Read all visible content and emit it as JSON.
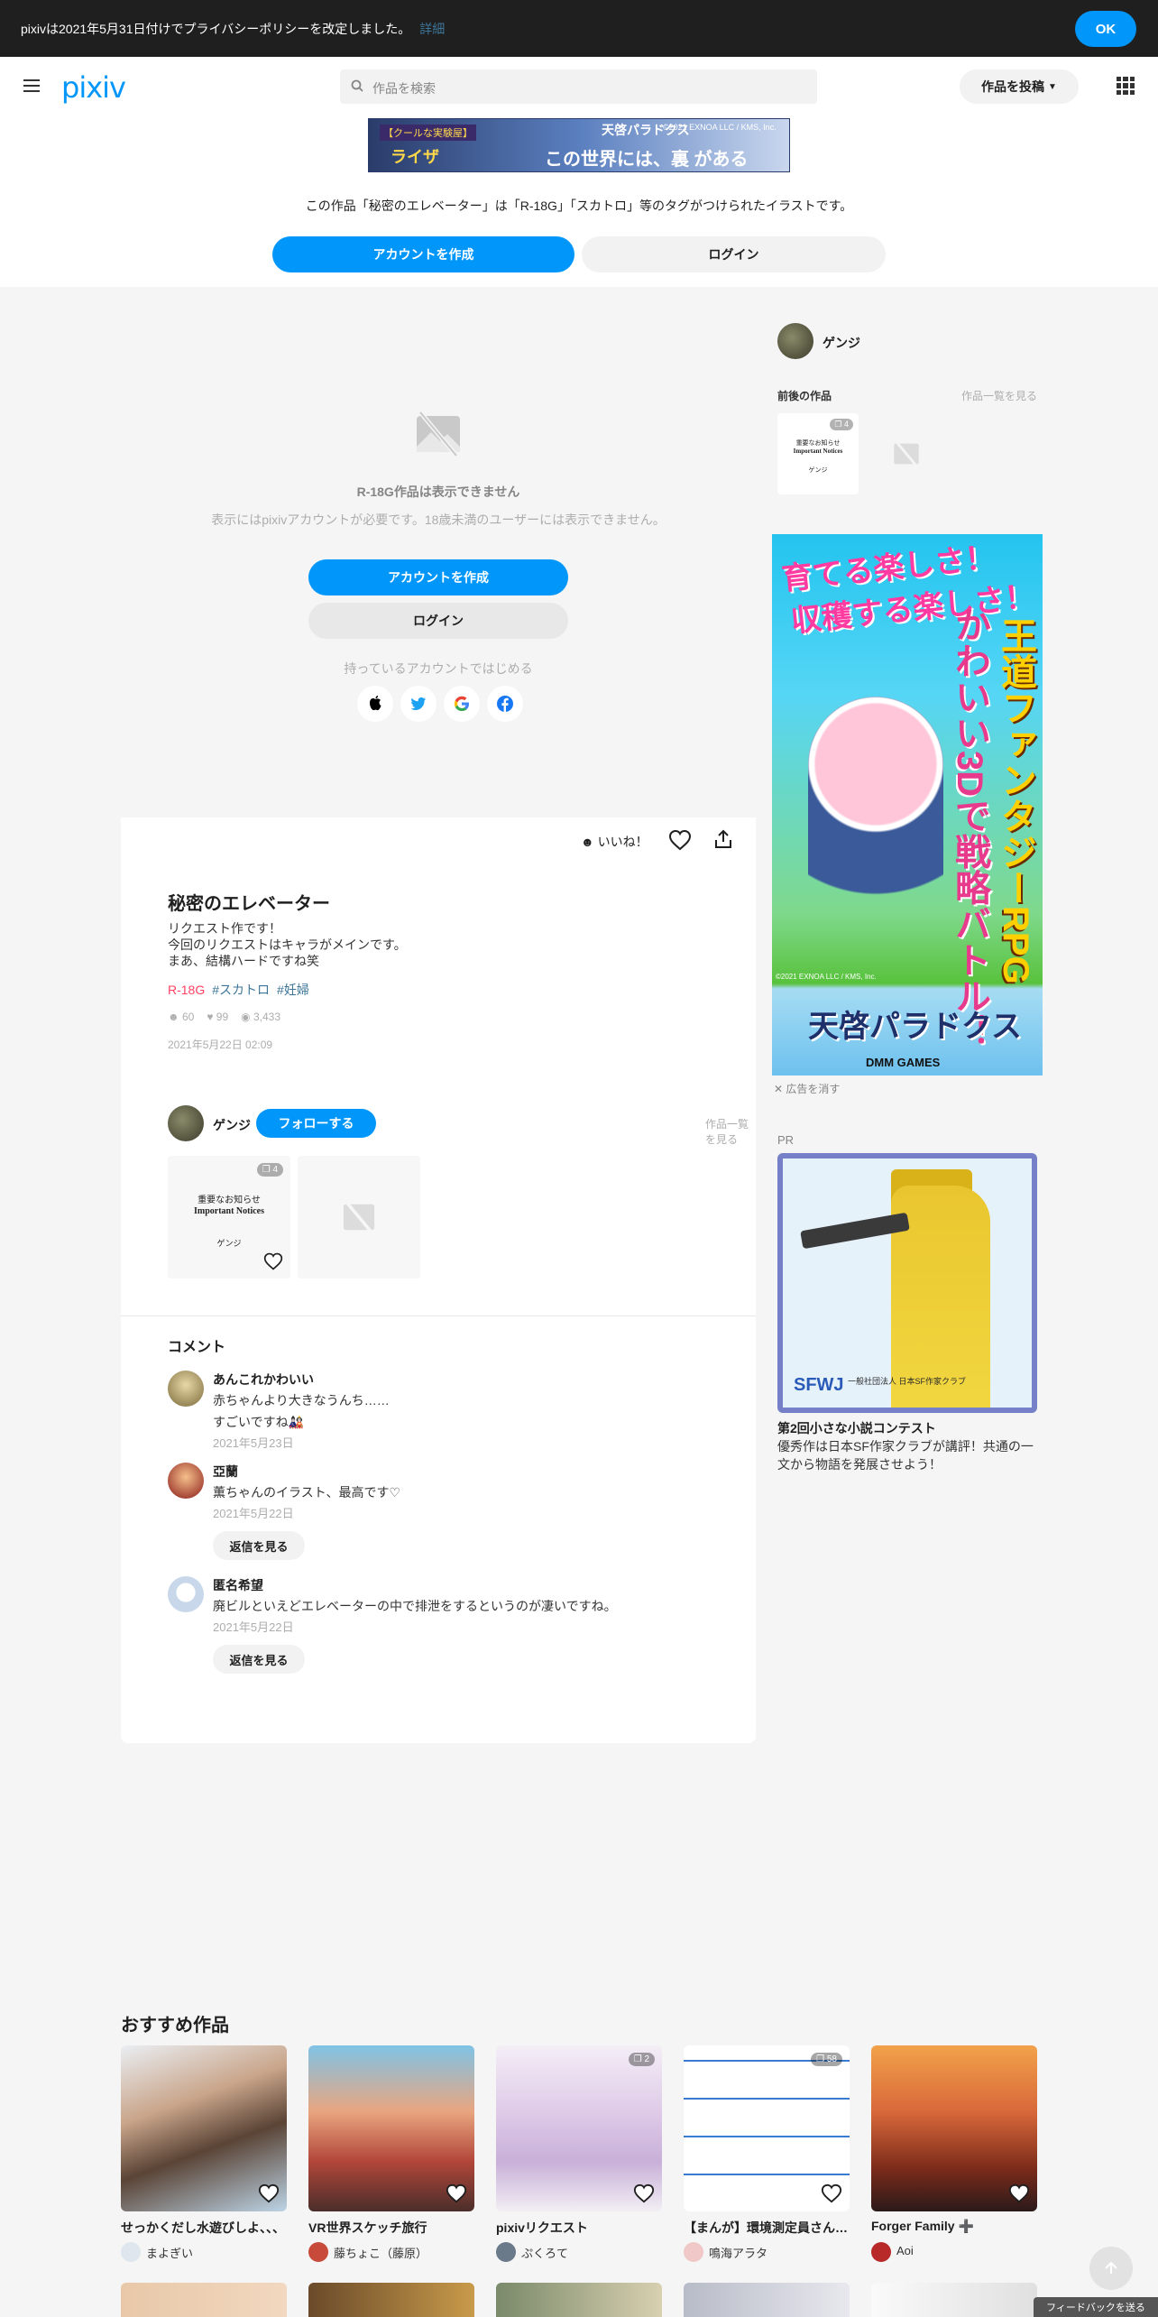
{
  "privacy": {
    "text": "pixivは2021年5月31日付けでプライバシーポリシーを改定しました。",
    "link": "詳細",
    "ok": "OK"
  },
  "header": {
    "logo": "pixiv",
    "search_placeholder": "作品を検索",
    "post_button": "作品を投稿"
  },
  "top_ad": {
    "badge": "【クールな実験屋】",
    "name": "ライザ",
    "game": "天啓パラドクス",
    "copyright": "©2021 EXNOA LLC / KMS, Inc.",
    "slogan": "この世界には、裏 がある"
  },
  "notice": "この作品「秘密のエレベーター」は「R-18G」「スカトロ」等のタグがつけられたイラストです。",
  "auth": {
    "create": "アカウントを作成",
    "login": "ログイン"
  },
  "blocked": {
    "title": "R-18G作品は表示できません",
    "subtitle": "表示にはpixivアカウントが必要です。18歳未満のユーザーには表示できません。",
    "create": "アカウントを作成",
    "login": "ログイン",
    "existing": "持っているアカウントではじめる"
  },
  "work": {
    "like_label": "いいね！",
    "title": "秘密のエレベーター",
    "description": [
      "リクエスト作です！",
      "今回のリクエストはキャラがメインです。",
      "まあ、結構ハードですね笑"
    ],
    "tags": [
      "R-18G",
      "#スカトロ",
      "#妊婦"
    ],
    "likes": "60",
    "bookmarks": "99",
    "views": "3,433",
    "date": "2021年5月22日 02:09"
  },
  "author": {
    "name": "ゲンジ",
    "follow": "フォローする",
    "see_all": "作品一覧を見る",
    "thumb": {
      "pages": "4",
      "line1": "重要なお知らせ",
      "line2": "Important Notices",
      "line3": "ゲンジ"
    }
  },
  "comments": {
    "heading": "コメント",
    "items": [
      {
        "name": "あんこれかわいい",
        "lines": [
          "赤ちゃんより大きなうんち……",
          "すごいですね🎎"
        ],
        "date": "2021年5月23日",
        "reply": ""
      },
      {
        "name": "亞蘭",
        "lines": [
          "薫ちゃんのイラスト、最高です♡"
        ],
        "date": "2021年5月22日",
        "reply": "返信を見る"
      },
      {
        "name": "匿名希望",
        "lines": [
          "廃ビルといえどエレベーターの中で排泄をするというのが凄いですね。"
        ],
        "date": "2021年5月22日",
        "reply": "返信を見る"
      }
    ]
  },
  "sidebar": {
    "author_name": "ゲンジ",
    "prev_next": "前後の作品",
    "see_all": "作品一覧を見る",
    "thumb": {
      "pages": "4",
      "line1": "重要なお知らせ",
      "line2": "Important Notices",
      "line3": "ゲンジ"
    },
    "ad": {
      "line1": "育てる楽しさ！",
      "line2": "収穫する楽しさ！",
      "vert1": "かわいい3Dで戦略バトル！",
      "vert2": "王道ファンタジーRPG",
      "copyright": "©2021 EXNOA LLC / KMS, Inc.",
      "logo": "天啓パラドクス",
      "brand": "DMM GAMES"
    },
    "ad_close": "広告を消す",
    "pr_label": "PR",
    "pr_logo": "SFWJ",
    "pr_org": "一般社団法人 日本SF作家クラブ",
    "pr_title": "第2回小さな小説コンテスト",
    "pr_desc": "優秀作は日本SF作家クラブが講評！共通の一文から物語を発展させよう！"
  },
  "recommended": {
    "heading": "おすすめ作品",
    "items": [
      {
        "title": "せっかくだし水遊びしよ、、、",
        "user": "まよぎい",
        "pages": ""
      },
      {
        "title": "VR世界スケッチ旅行",
        "user": "藤ちょこ（藤原）",
        "pages": ""
      },
      {
        "title": "pixivリクエスト",
        "user": "ぷくろて",
        "pages": "2"
      },
      {
        "title": "【まんが】環境測定員さん…",
        "user": "鳴海アラタ",
        "pages": "58"
      },
      {
        "title": "Forger Family ➕",
        "user": "Aoi",
        "pages": ""
      }
    ]
  },
  "feedback": "フィードバックを送る",
  "colors": {
    "accent": "#0096fa",
    "r18": "#ff4060",
    "tag": "#3d7699"
  }
}
